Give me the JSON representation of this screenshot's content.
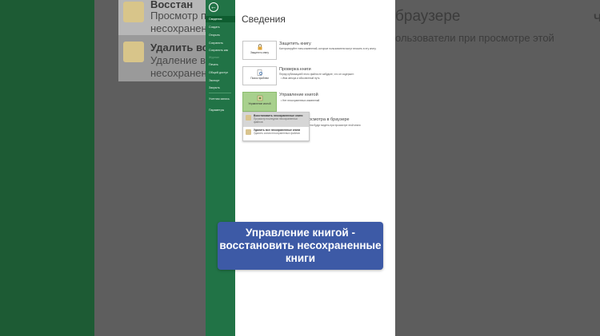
{
  "backstage": {
    "back_icon": "arrow-left-icon",
    "nav_items": [
      "Сведения",
      "Создать",
      "Открыть",
      "Сохранить",
      "Сохранить как",
      "Печать",
      "Общий доступ",
      "Экспорт",
      "Закрыть",
      "Учетная запись",
      "Параметры"
    ],
    "nav_disabled": "Журнал",
    "active_item": "Сведения"
  },
  "info": {
    "title": "Сведения",
    "protect": {
      "tile_label": "Защитить книгу",
      "title": "Защитить книгу",
      "desc": "Контролируйте типы изменений, которые пользователи могут вносить в эту книгу."
    },
    "inspect": {
      "tile_label": "Поиск проблем",
      "title": "Проверка книги",
      "desc": "Перед публикацией этого файла не забудьте, что он содержит:",
      "bullet": "Имя автора и абсолютный путь"
    },
    "manage": {
      "tile_label": "Управление книгой",
      "title": "Управление книгой",
      "bullet": "Нет несохраненных изменений"
    },
    "browser": {
      "title": "Параметры просмотра в браузере",
      "desc": "Выберите, что пользователи будут видеть при просмотре этой книги"
    }
  },
  "dropdown": {
    "items": [
      {
        "title": "Восстановить несохраненные книги",
        "sub": "Просмотр последних несохраненных файлов",
        "icon": "recover-file-icon"
      },
      {
        "title": "Удалить все несохраненные книги",
        "sub": "Удалить копии несохраненных файлов",
        "icon": "delete-file-icon"
      }
    ]
  },
  "zoom_background": {
    "popup_title_1": "Восстан",
    "popup_sub_1a": "Просмотр пос",
    "popup_sub_1b": "несохранен",
    "popup_title_2": "Удалить все",
    "popup_sub_2a": "Удаление все",
    "popup_sub_2b": "несохраненны",
    "right_big": "браузере",
    "right_mid": "ользователи при просмотре этой",
    "right_edge": "Ч"
  },
  "caption": {
    "line1": "Управление книгой -",
    "line2": "восстановить несохраненные",
    "line3": "книги"
  },
  "colors": {
    "backstage_green": "#217346",
    "caption_blue": "#3d5aa6",
    "tile_green": "#a8d08d"
  }
}
